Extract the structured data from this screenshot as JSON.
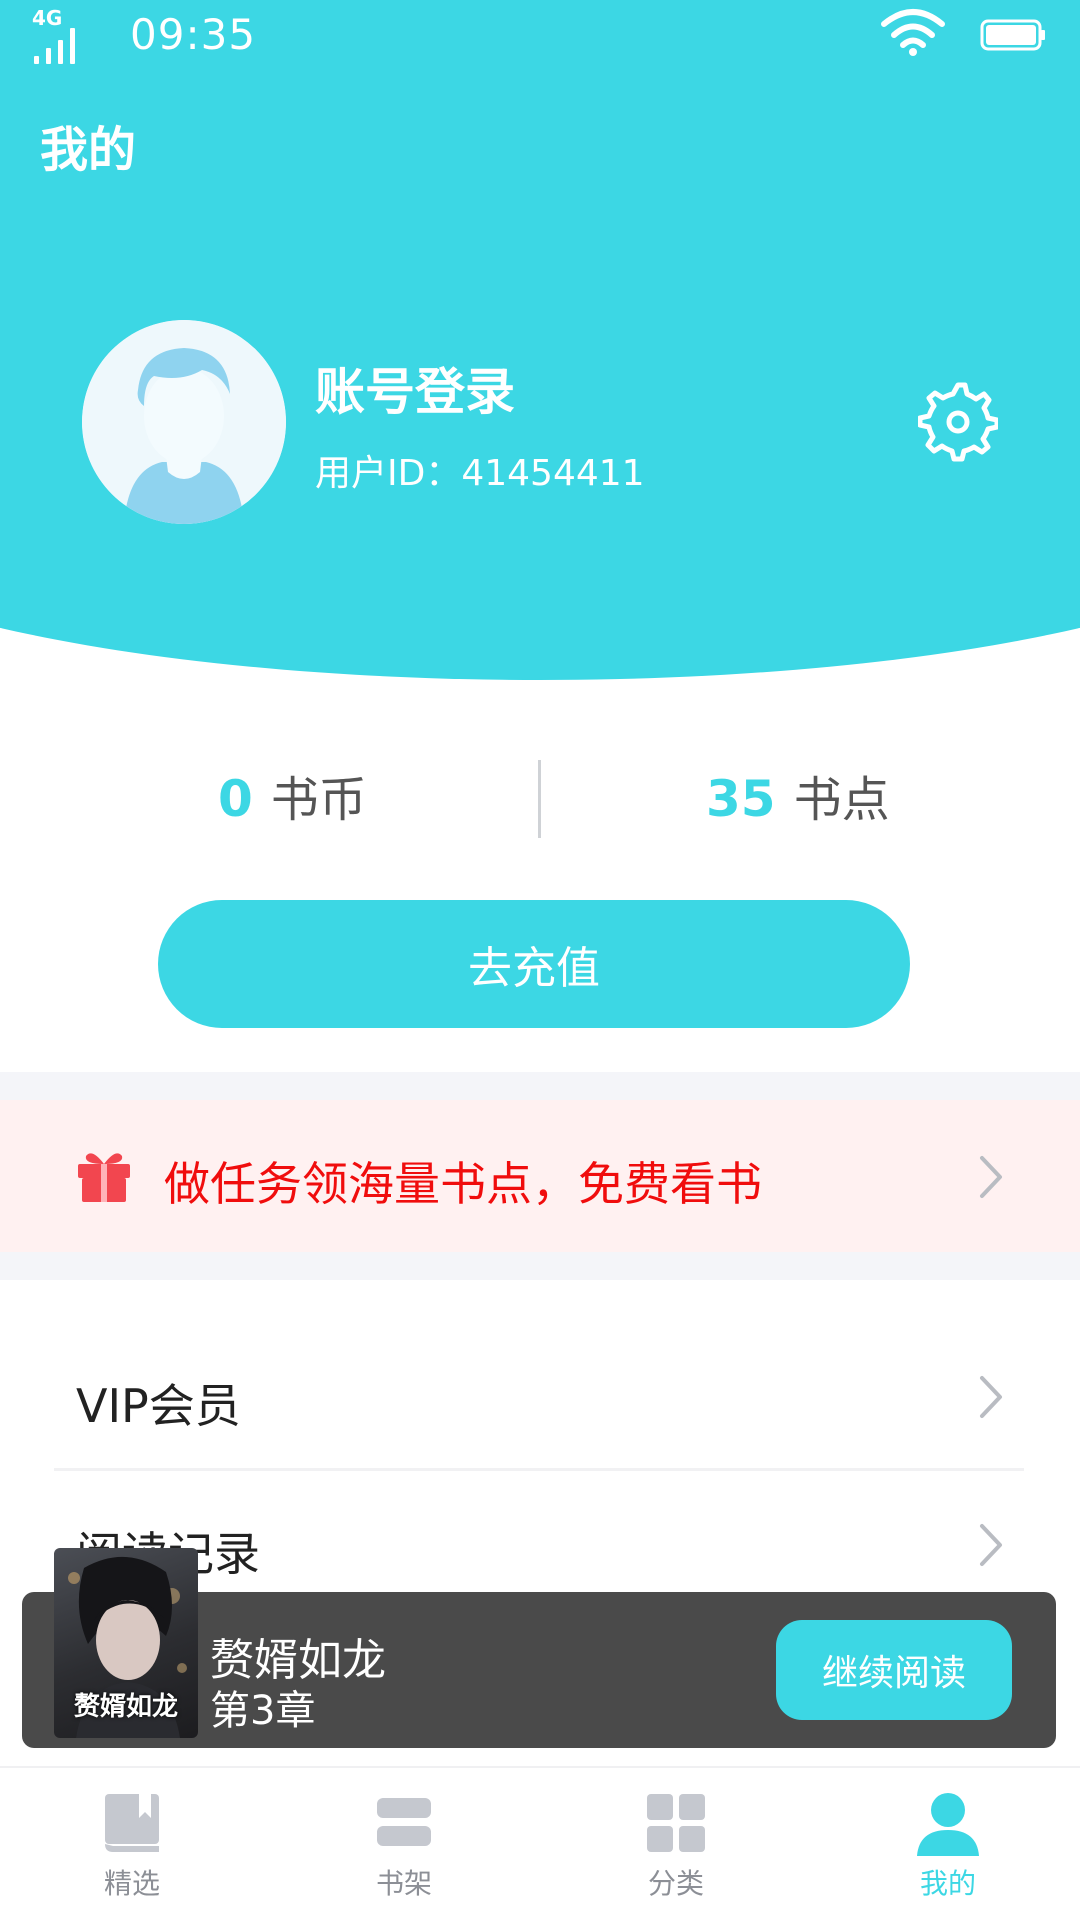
{
  "status_bar": {
    "network": "4G",
    "time": "09:35",
    "icons": [
      "signal-icon",
      "wifi-icon",
      "battery-icon"
    ]
  },
  "header": {
    "title": "我的",
    "account_title": "账号登录",
    "user_id": "用户ID：41454411",
    "settings_icon": "gear-icon"
  },
  "balance": {
    "coins_value": "0",
    "coins_label": "书币",
    "points_value": "35",
    "points_label": "书点"
  },
  "recharge_label": "去充值",
  "task_banner": {
    "text": "做任务领海量书点，免费看书",
    "icon": "gift-icon"
  },
  "menu": {
    "items": [
      {
        "label": "VIP会员"
      },
      {
        "label": "阅读记录"
      }
    ]
  },
  "continue_reading": {
    "book_title": "赘婿如龙",
    "chapter": "第3章",
    "button_label": "继续阅读",
    "cover_title": "赘婿如龙"
  },
  "bottom_nav": {
    "items": [
      {
        "label": "精选",
        "icon": "book-icon"
      },
      {
        "label": "书架",
        "icon": "bookshelf-icon"
      },
      {
        "label": "分类",
        "icon": "grid-icon"
      },
      {
        "label": "我的",
        "icon": "user-icon"
      }
    ],
    "active_index": 3
  },
  "colors": {
    "accent": "#3cd7e4",
    "task_text": "#f00d0d",
    "task_bg": "#fff1f1",
    "continue_bar_bg": "#4a4a4a"
  }
}
